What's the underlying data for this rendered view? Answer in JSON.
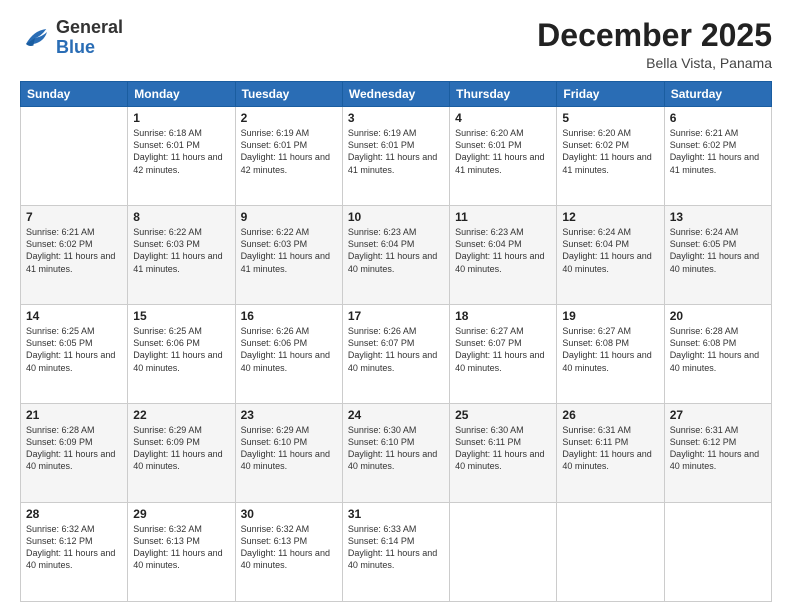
{
  "logo": {
    "general": "General",
    "blue": "Blue"
  },
  "header": {
    "month": "December 2025",
    "location": "Bella Vista, Panama"
  },
  "days_of_week": [
    "Sunday",
    "Monday",
    "Tuesday",
    "Wednesday",
    "Thursday",
    "Friday",
    "Saturday"
  ],
  "weeks": [
    [
      {
        "day": null,
        "sunrise": null,
        "sunset": null,
        "daylight": null
      },
      {
        "day": "1",
        "sunrise": "Sunrise: 6:18 AM",
        "sunset": "Sunset: 6:01 PM",
        "daylight": "Daylight: 11 hours and 42 minutes."
      },
      {
        "day": "2",
        "sunrise": "Sunrise: 6:19 AM",
        "sunset": "Sunset: 6:01 PM",
        "daylight": "Daylight: 11 hours and 42 minutes."
      },
      {
        "day": "3",
        "sunrise": "Sunrise: 6:19 AM",
        "sunset": "Sunset: 6:01 PM",
        "daylight": "Daylight: 11 hours and 41 minutes."
      },
      {
        "day": "4",
        "sunrise": "Sunrise: 6:20 AM",
        "sunset": "Sunset: 6:01 PM",
        "daylight": "Daylight: 11 hours and 41 minutes."
      },
      {
        "day": "5",
        "sunrise": "Sunrise: 6:20 AM",
        "sunset": "Sunset: 6:02 PM",
        "daylight": "Daylight: 11 hours and 41 minutes."
      },
      {
        "day": "6",
        "sunrise": "Sunrise: 6:21 AM",
        "sunset": "Sunset: 6:02 PM",
        "daylight": "Daylight: 11 hours and 41 minutes."
      }
    ],
    [
      {
        "day": "7",
        "sunrise": "Sunrise: 6:21 AM",
        "sunset": "Sunset: 6:02 PM",
        "daylight": "Daylight: 11 hours and 41 minutes."
      },
      {
        "day": "8",
        "sunrise": "Sunrise: 6:22 AM",
        "sunset": "Sunset: 6:03 PM",
        "daylight": "Daylight: 11 hours and 41 minutes."
      },
      {
        "day": "9",
        "sunrise": "Sunrise: 6:22 AM",
        "sunset": "Sunset: 6:03 PM",
        "daylight": "Daylight: 11 hours and 41 minutes."
      },
      {
        "day": "10",
        "sunrise": "Sunrise: 6:23 AM",
        "sunset": "Sunset: 6:04 PM",
        "daylight": "Daylight: 11 hours and 40 minutes."
      },
      {
        "day": "11",
        "sunrise": "Sunrise: 6:23 AM",
        "sunset": "Sunset: 6:04 PM",
        "daylight": "Daylight: 11 hours and 40 minutes."
      },
      {
        "day": "12",
        "sunrise": "Sunrise: 6:24 AM",
        "sunset": "Sunset: 6:04 PM",
        "daylight": "Daylight: 11 hours and 40 minutes."
      },
      {
        "day": "13",
        "sunrise": "Sunrise: 6:24 AM",
        "sunset": "Sunset: 6:05 PM",
        "daylight": "Daylight: 11 hours and 40 minutes."
      }
    ],
    [
      {
        "day": "14",
        "sunrise": "Sunrise: 6:25 AM",
        "sunset": "Sunset: 6:05 PM",
        "daylight": "Daylight: 11 hours and 40 minutes."
      },
      {
        "day": "15",
        "sunrise": "Sunrise: 6:25 AM",
        "sunset": "Sunset: 6:06 PM",
        "daylight": "Daylight: 11 hours and 40 minutes."
      },
      {
        "day": "16",
        "sunrise": "Sunrise: 6:26 AM",
        "sunset": "Sunset: 6:06 PM",
        "daylight": "Daylight: 11 hours and 40 minutes."
      },
      {
        "day": "17",
        "sunrise": "Sunrise: 6:26 AM",
        "sunset": "Sunset: 6:07 PM",
        "daylight": "Daylight: 11 hours and 40 minutes."
      },
      {
        "day": "18",
        "sunrise": "Sunrise: 6:27 AM",
        "sunset": "Sunset: 6:07 PM",
        "daylight": "Daylight: 11 hours and 40 minutes."
      },
      {
        "day": "19",
        "sunrise": "Sunrise: 6:27 AM",
        "sunset": "Sunset: 6:08 PM",
        "daylight": "Daylight: 11 hours and 40 minutes."
      },
      {
        "day": "20",
        "sunrise": "Sunrise: 6:28 AM",
        "sunset": "Sunset: 6:08 PM",
        "daylight": "Daylight: 11 hours and 40 minutes."
      }
    ],
    [
      {
        "day": "21",
        "sunrise": "Sunrise: 6:28 AM",
        "sunset": "Sunset: 6:09 PM",
        "daylight": "Daylight: 11 hours and 40 minutes."
      },
      {
        "day": "22",
        "sunrise": "Sunrise: 6:29 AM",
        "sunset": "Sunset: 6:09 PM",
        "daylight": "Daylight: 11 hours and 40 minutes."
      },
      {
        "day": "23",
        "sunrise": "Sunrise: 6:29 AM",
        "sunset": "Sunset: 6:10 PM",
        "daylight": "Daylight: 11 hours and 40 minutes."
      },
      {
        "day": "24",
        "sunrise": "Sunrise: 6:30 AM",
        "sunset": "Sunset: 6:10 PM",
        "daylight": "Daylight: 11 hours and 40 minutes."
      },
      {
        "day": "25",
        "sunrise": "Sunrise: 6:30 AM",
        "sunset": "Sunset: 6:11 PM",
        "daylight": "Daylight: 11 hours and 40 minutes."
      },
      {
        "day": "26",
        "sunrise": "Sunrise: 6:31 AM",
        "sunset": "Sunset: 6:11 PM",
        "daylight": "Daylight: 11 hours and 40 minutes."
      },
      {
        "day": "27",
        "sunrise": "Sunrise: 6:31 AM",
        "sunset": "Sunset: 6:12 PM",
        "daylight": "Daylight: 11 hours and 40 minutes."
      }
    ],
    [
      {
        "day": "28",
        "sunrise": "Sunrise: 6:32 AM",
        "sunset": "Sunset: 6:12 PM",
        "daylight": "Daylight: 11 hours and 40 minutes."
      },
      {
        "day": "29",
        "sunrise": "Sunrise: 6:32 AM",
        "sunset": "Sunset: 6:13 PM",
        "daylight": "Daylight: 11 hours and 40 minutes."
      },
      {
        "day": "30",
        "sunrise": "Sunrise: 6:32 AM",
        "sunset": "Sunset: 6:13 PM",
        "daylight": "Daylight: 11 hours and 40 minutes."
      },
      {
        "day": "31",
        "sunrise": "Sunrise: 6:33 AM",
        "sunset": "Sunset: 6:14 PM",
        "daylight": "Daylight: 11 hours and 40 minutes."
      },
      {
        "day": null,
        "sunrise": null,
        "sunset": null,
        "daylight": null
      },
      {
        "day": null,
        "sunrise": null,
        "sunset": null,
        "daylight": null
      },
      {
        "day": null,
        "sunrise": null,
        "sunset": null,
        "daylight": null
      }
    ]
  ]
}
